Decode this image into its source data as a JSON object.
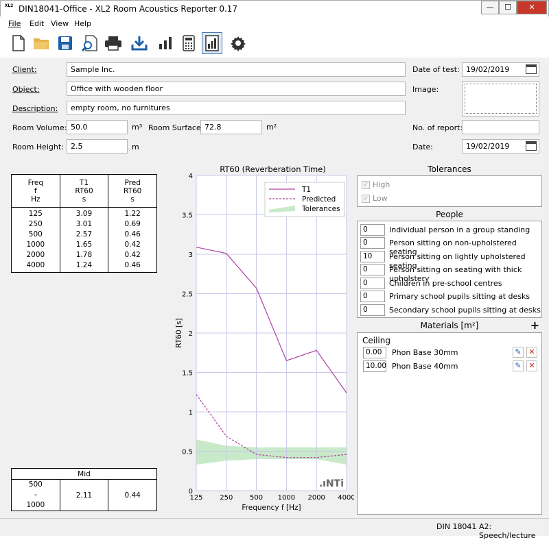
{
  "window": {
    "title": "DIN18041-Office - XL2 Room Acoustics Reporter 0.17",
    "icon_text": "XL2",
    "minimize": "—",
    "maximize": "☐",
    "close": "✕"
  },
  "menu": [
    "File",
    "Edit",
    "View",
    "Help"
  ],
  "toolbar": [
    "new-file",
    "open-folder",
    "save",
    "print-preview",
    "print",
    "download",
    "bar-chart",
    "calculator",
    "report-view",
    "settings"
  ],
  "form": {
    "client_label": "Client:",
    "client": "Sample Inc.",
    "object_label": "Object:",
    "object": "Office with wooden floor",
    "description_label": "Description:",
    "description": "empty room, no furnitures",
    "room_volume_label": "Room Volume:",
    "room_volume": "50.0",
    "room_volume_unit": "m³",
    "room_surface_label": "Room Surface:",
    "room_surface": "72.8",
    "room_surface_unit": "m²",
    "room_height_label": "Room Height:",
    "room_height": "2.5",
    "room_height_unit": "m",
    "date_of_test_label": "Date of test:",
    "date_of_test": "19/02/2019",
    "image_label": "Image:",
    "report_no_label": "No. of report:",
    "report_no": "",
    "date_label": "Date:",
    "date": "19/02/2019"
  },
  "table": {
    "headers": [
      [
        "Freq",
        "f",
        "Hz"
      ],
      [
        "T1",
        "RT60",
        "s"
      ],
      [
        "Pred",
        "RT60",
        "s"
      ]
    ],
    "rows": [
      [
        "125",
        "3.09",
        "1.22"
      ],
      [
        "250",
        "3.01",
        "0.69"
      ],
      [
        "500",
        "2.57",
        "0.46"
      ],
      [
        "1000",
        "1.65",
        "0.42"
      ],
      [
        "2000",
        "1.78",
        "0.42"
      ],
      [
        "4000",
        "1.24",
        "0.46"
      ]
    ]
  },
  "mid": {
    "header": "Mid",
    "range_from": "500",
    "range_sep": "-",
    "range_to": "1000",
    "t1": "2.11",
    "pred": "0.44"
  },
  "chart_data": {
    "type": "line",
    "title": "RT60 (Reverberation Time)",
    "xlabel": "Frequency f [Hz]",
    "ylabel": "RT60 [s]",
    "x": [
      125,
      250,
      500,
      1000,
      2000,
      4000
    ],
    "xticks": [
      "125",
      "250",
      "500",
      "1000",
      "2000",
      "4000"
    ],
    "yticks": [
      "0",
      "0.5",
      "1",
      "1.5",
      "2",
      "2.5",
      "3",
      "3.5",
      "4"
    ],
    "ylim": [
      0,
      4
    ],
    "grid": true,
    "legend_position": "top-right",
    "logo": ".ıNTi",
    "series": [
      {
        "name": "T1",
        "values": [
          3.09,
          3.01,
          2.57,
          1.65,
          1.78,
          1.24
        ],
        "color": "#b040a0",
        "style": "solid"
      },
      {
        "name": "Predicted",
        "values": [
          1.22,
          0.69,
          0.46,
          0.42,
          0.42,
          0.46
        ],
        "color": "#b040a0",
        "style": "dashed"
      }
    ],
    "tolerances": {
      "name": "Tolerances",
      "upper": [
        0.65,
        0.57,
        0.55,
        0.55,
        0.55,
        0.55
      ],
      "lower": [
        0.33,
        0.38,
        0.4,
        0.4,
        0.4,
        0.33
      ],
      "color": "#c8eac8"
    }
  },
  "tolerances": {
    "title": "Tolerances",
    "high": "High",
    "low": "Low"
  },
  "people": {
    "title": "People",
    "items": [
      {
        "value": "0",
        "label": "Individual person in a group standing"
      },
      {
        "value": "0",
        "label": "Person sitting on non-upholstered seating"
      },
      {
        "value": "10",
        "label": "Person sitting on lightly upholstered seating"
      },
      {
        "value": "0",
        "label": "Person sitting on seating with thick upholstery"
      },
      {
        "value": "0",
        "label": "Children in pre-school centres"
      },
      {
        "value": "0",
        "label": "Primary school pupils sitting at desks"
      },
      {
        "value": "0",
        "label": "Secondary school pupils sitting at desks"
      }
    ]
  },
  "materials": {
    "title": "Materials [m²]",
    "group": "Ceiling",
    "items": [
      {
        "value": "0.00",
        "label": "Phon Base 30mm"
      },
      {
        "value": "10.00",
        "label": "Phon Base 40mm"
      }
    ]
  },
  "status": {
    "standard": "DIN 18041",
    "usecase": "A2: Speech/lecture"
  }
}
